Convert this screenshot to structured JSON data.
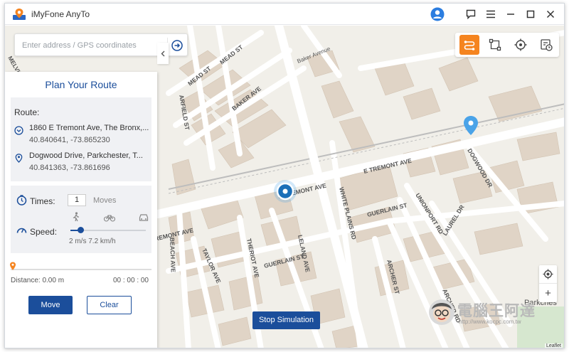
{
  "window": {
    "title": "iMyFone AnyTo"
  },
  "icons": {
    "app": "map-pin-logo-icon",
    "account": "user-avatar-icon",
    "feedback": "chat-icon",
    "menu": "hamburger-menu-icon",
    "minimize": "minimize-icon",
    "maximize": "maximize-icon",
    "close": "close-icon"
  },
  "search": {
    "placeholder": "Enter address / GPS coordinates",
    "value": ""
  },
  "modes": [
    {
      "name": "multi-stop-route",
      "active": true
    },
    {
      "name": "two-spot-route",
      "active": false
    },
    {
      "name": "jump-teleport",
      "active": false
    },
    {
      "name": "history",
      "active": false
    }
  ],
  "panel": {
    "title": "Plan Your Route",
    "route_label": "Route:",
    "start": {
      "name": "1860 E Tremont Ave, The Bronx,...",
      "coords": "40.840641, -73.865230"
    },
    "end": {
      "name": "Dogwood Drive, Parkchester, T...",
      "coords": "40.841363, -73.861696"
    },
    "times_label": "Times:",
    "times_value": "1",
    "moves_label": "Moves",
    "speed_label": "Speed:",
    "speed_value": "2 m/s 7.2 km/h",
    "speed_modes": [
      "walk",
      "bike",
      "car"
    ],
    "distance": "Distance: 0.00 m",
    "time": "00 : 00 : 00",
    "progress": 0,
    "move_label": "Move",
    "clear_label": "Clear"
  },
  "map": {
    "streets": {
      "e_tremont_1": "E TREMONT AVE",
      "e_tremont_2": "E TREMONT AVE",
      "e_tremont_3": "TREMONT AVE",
      "white_plains": "WHITE PLAINS RD",
      "mead_1": "MEAD ST",
      "mead_2": "MEAD ST",
      "baker_1": "BAKER AVE",
      "baker_2": "Baker Avenue",
      "garfield": "ARFIELD ST",
      "dogwood": "DOGWOOD DR",
      "guerlain_1": "GUERLAIN ST",
      "guerlain_2": "GUERLAIN ST",
      "unionport": "UNIONPORT RD",
      "laurel": "LAUREL DR",
      "archer_1": "ARCHER ST",
      "archer_2": "ARCHER RD",
      "leland": "LELAND AVE",
      "theriot": "THERIOT AVE",
      "taylor": "TAYLOR AVE",
      "beach": "BEACH AVE",
      "melville": "MELVIL",
      "parkchester": "Parkches"
    },
    "stop_simulation_label": "Stop Simulation",
    "zoom_in": "+",
    "attribution": "Leaflet"
  },
  "watermark": {
    "text": "電腦王阿達",
    "url": "http://www.kocpc.com.tw"
  },
  "colors": {
    "accent": "#1b4e9b",
    "orange": "#f5841f",
    "pin": "#4aa3e8"
  }
}
